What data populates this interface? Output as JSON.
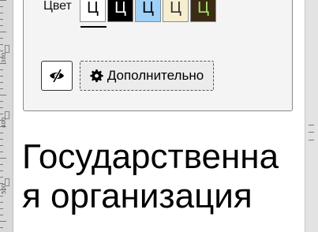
{
  "ruler": {
    "labels": [
      "300",
      "400",
      "500"
    ]
  },
  "settings": {
    "color_label": "Цвет",
    "swatches": [
      {
        "glyph": "Ц",
        "bg": "#ffffff",
        "fg": "#000000"
      },
      {
        "glyph": "Ц",
        "bg": "#000000",
        "fg": "#ffffff"
      },
      {
        "glyph": "Ц",
        "bg": "#9fd0f7",
        "fg": "#000000"
      },
      {
        "glyph": "Ц",
        "bg": "#f6efcf",
        "fg": "#333333"
      },
      {
        "glyph": "Ц",
        "bg": "#3b2a14",
        "fg": "#a6e36a"
      }
    ],
    "selected_swatch": 0,
    "hide_button_icon": "eye-slash-icon",
    "more_button_icon": "gear-icon",
    "more_button_label": "Дополнительно"
  },
  "main": {
    "org_title": "Государственная организация"
  }
}
